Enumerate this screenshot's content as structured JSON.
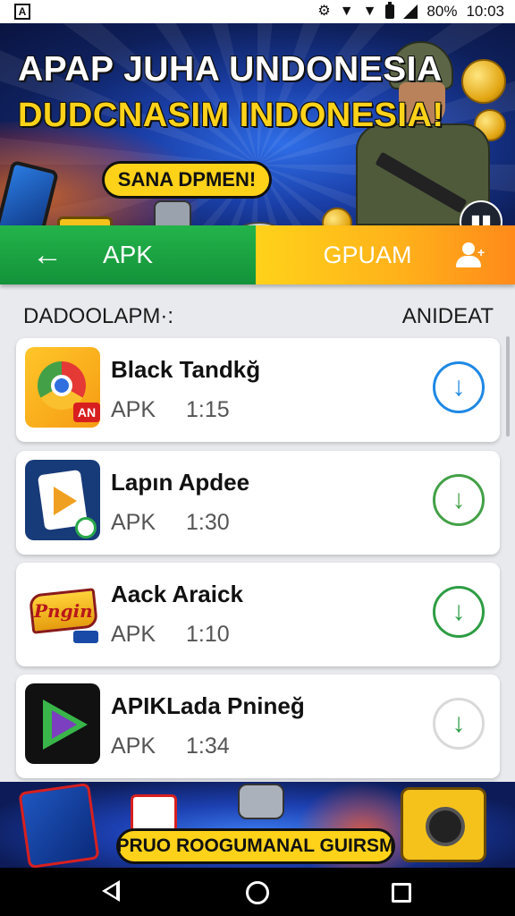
{
  "status_bar": {
    "app_icon_label": "A",
    "battery_text": "80%",
    "time": "10:03",
    "icons": [
      "settings-icon",
      "wifi-icon",
      "wifi-icon",
      "battery-icon",
      "signal-icon"
    ]
  },
  "top_banner": {
    "title_line1": "APAP JUHA UNDONESIA",
    "title_line2": "DUDCNASIM INDONESIA!",
    "pill_label": "SANA DPMEN!",
    "icon_button": "bookmark-icon"
  },
  "tabs": {
    "left_label": "APK",
    "right_label": "GPUAM",
    "back_icon": "back-arrow-icon",
    "user_icon": "add-user-icon"
  },
  "section": {
    "left_label": "DADOOLAPM·:",
    "right_label": "ANIDEAT"
  },
  "apps": [
    {
      "name": "Black Tandkğ",
      "type": "APK",
      "time": "1:15",
      "icon": "chrome-app-icon",
      "icon_tag": "AN",
      "download_color": "#1e88e5"
    },
    {
      "name": "Lapın Apdee",
      "type": "APK",
      "time": "1:30",
      "icon": "play-app-icon",
      "download_color": "#43a047"
    },
    {
      "name": "Aack Araick",
      "type": "APK",
      "time": "1:10",
      "icon": "pngin-app-icon",
      "icon_word": "Pngin",
      "download_color": "#2e9d44"
    },
    {
      "name": "APIKLada Pnineğ",
      "type": "APK",
      "time": "1:34",
      "icon": "dark-play-app-icon",
      "download_color": "#2e9d44"
    }
  ],
  "bottom_banner": {
    "pill_label": "PRUO ROOGUMANAL GUIRSM"
  },
  "nav_bar": {
    "icons": [
      "back-nav-icon",
      "home-nav-icon",
      "recents-nav-icon"
    ]
  },
  "colors": {
    "tab_green": "#13923a",
    "tab_yellow": "#ffd21a",
    "banner_blue": "#1a3fa8",
    "pill_yellow": "#ffd21a"
  }
}
